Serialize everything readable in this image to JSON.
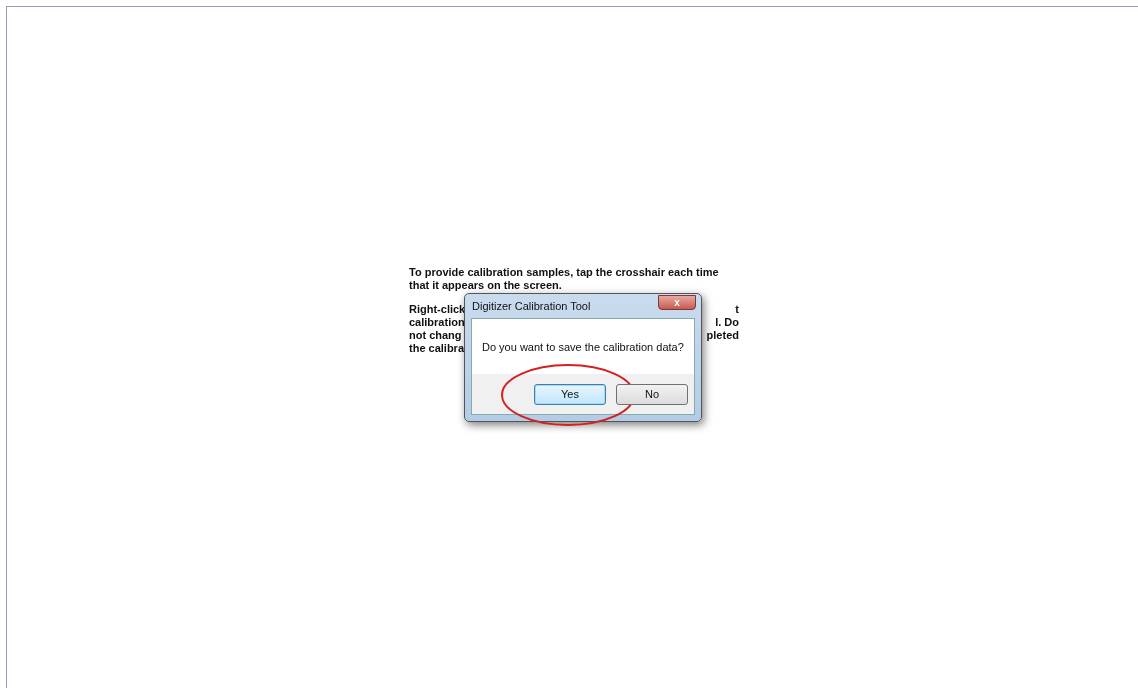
{
  "instructions": {
    "intro": "To provide calibration samples, tap the crosshair each time that it appears on the screen.",
    "left_fragments": [
      "Right-click",
      "calibration",
      "not chang",
      "the calibra"
    ],
    "right_fragments": [
      "t",
      "l. Do",
      "pleted"
    ]
  },
  "dialog": {
    "title": "Digitizer Calibration Tool",
    "close": "x",
    "message": "Do you want to save the calibration data?",
    "buttons": [
      {
        "label": "Yes",
        "focused": true,
        "circled": true
      },
      {
        "label": "No",
        "focused": false,
        "circled": false
      }
    ]
  }
}
